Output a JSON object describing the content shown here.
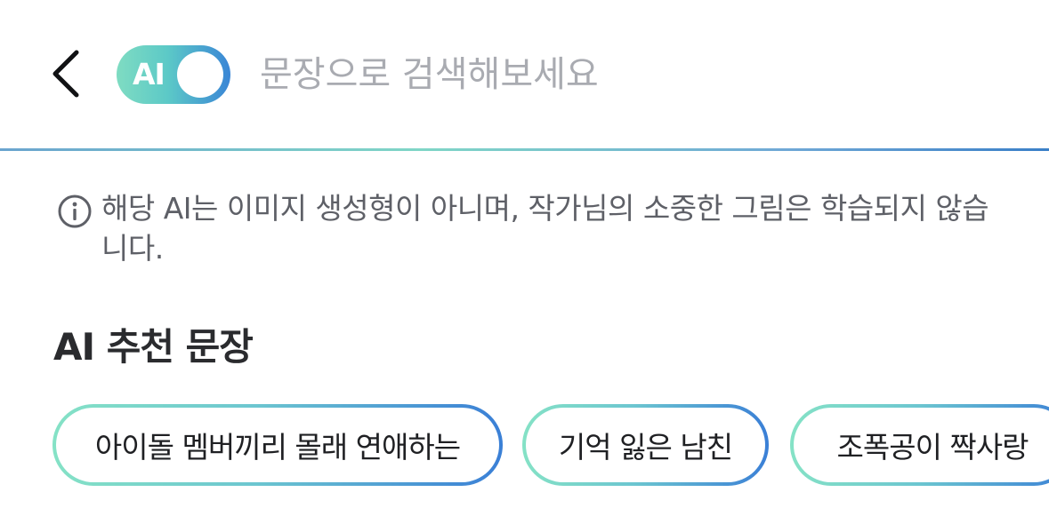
{
  "header": {
    "back_icon": "chevron-left-icon",
    "ai_toggle": {
      "label": "AI",
      "on": true,
      "colors": [
        "#7fdcc2",
        "#3a86d6"
      ]
    },
    "search": {
      "placeholder": "문장으로 검색해보세요",
      "value": ""
    }
  },
  "notice": {
    "icon": "info-icon",
    "text": "해당 AI는 이미지 생성형이 아니며, 작가님의 소중한 그림은 학습되지 않습니다."
  },
  "recommend": {
    "title": "AI 추천 문장",
    "chips": [
      {
        "label": "아이돌 멤버끼리 몰래 연애하는"
      },
      {
        "label": "기억 잃은 남친"
      },
      {
        "label": "조폭공이 짝사랑"
      }
    ]
  }
}
